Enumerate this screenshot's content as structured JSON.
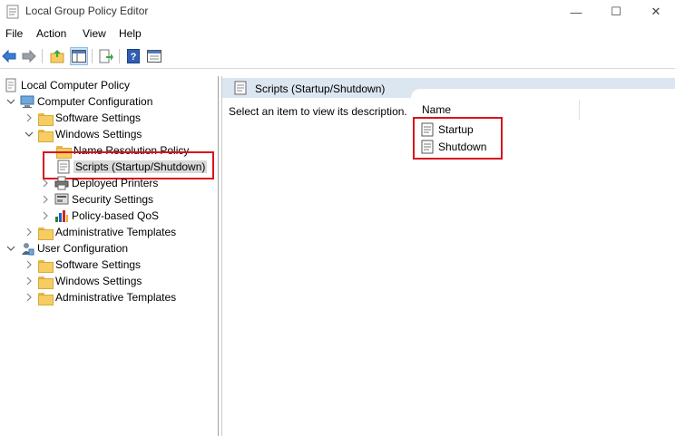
{
  "window": {
    "title": "Local Group Policy Editor",
    "min_glyph": "—",
    "max_glyph": "☐",
    "close_glyph": "✕"
  },
  "menu": {
    "file": "File",
    "action": "Action",
    "view": "View",
    "help": "Help"
  },
  "toolbar": {
    "icons": [
      "back-arrow-icon",
      "forward-arrow-icon",
      "up-folder-icon",
      "show-hide-tree-icon",
      "export-list-icon",
      "help-icon",
      "properties-icon"
    ]
  },
  "tree": {
    "root": "Local Computer Policy",
    "computer_config": "Computer Configuration",
    "cc_software": "Software Settings",
    "cc_windows": "Windows Settings",
    "name_resolution": "Name Resolution Policy",
    "scripts": "Scripts (Startup/Shutdown)",
    "deployed_printers": "Deployed Printers",
    "security_settings": "Security Settings",
    "qos": "Policy-based QoS",
    "cc_admin_templates": "Administrative Templates",
    "user_config": "User Configuration",
    "uc_software": "Software Settings",
    "uc_windows": "Windows Settings",
    "uc_admin_templates": "Administrative Templates"
  },
  "details": {
    "header_title": "Scripts (Startup/Shutdown)",
    "description": "Select an item to view its description.",
    "column_name": "Name",
    "items": [
      "Startup",
      "Shutdown"
    ]
  },
  "colors": {
    "highlight_box": "#d9141c",
    "header_band": "#dce6f1",
    "selected_bg": "#d9d9d9"
  }
}
